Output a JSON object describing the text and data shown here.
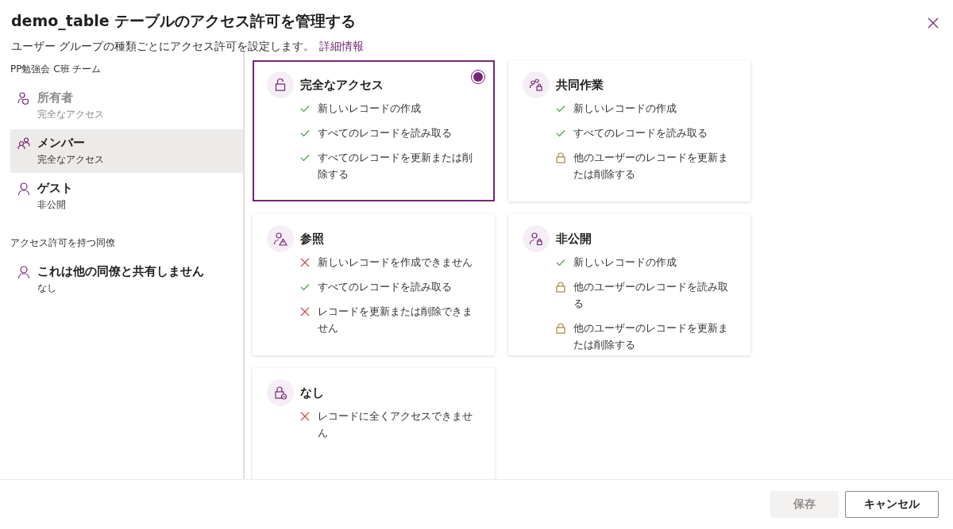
{
  "dialog": {
    "title_name": "demo_table",
    "title_rest": "テーブルのアクセス許可を管理する",
    "subtitle": "ユーザー グループの種類ごとにアクセス許可を設定します。",
    "link": "詳細情報"
  },
  "sidebar": {
    "sections": [
      {
        "heading": "PP勉強会 C班 チーム",
        "items": [
          {
            "name": "所有者",
            "access": "完全なアクセス",
            "selected": false,
            "disabled": true
          },
          {
            "name": "メンバー",
            "access": "完全なアクセス",
            "selected": true,
            "disabled": false
          },
          {
            "name": "ゲスト",
            "access": "非公開",
            "selected": false,
            "disabled": false
          }
        ]
      },
      {
        "heading": "アクセス許可を持つ同僚",
        "items": [
          {
            "name": "これは他の同僚と共有しません",
            "access": "なし",
            "selected": false,
            "disabled": false
          }
        ]
      }
    ]
  },
  "options": [
    {
      "title": "完全なアクセス",
      "selected": true,
      "features": [
        {
          "kind": "check",
          "text": "新しいレコードの作成"
        },
        {
          "kind": "check",
          "text": "すべてのレコードを読み取る"
        },
        {
          "kind": "check",
          "text": "すべてのレコードを更新または削除する"
        }
      ]
    },
    {
      "title": "共同作業",
      "selected": false,
      "features": [
        {
          "kind": "check",
          "text": "新しいレコードの作成"
        },
        {
          "kind": "check",
          "text": "すべてのレコードを読み取る"
        },
        {
          "kind": "lock",
          "text": "他のユーザーのレコードを更新または削除する"
        }
      ]
    },
    {
      "title": "参照",
      "selected": false,
      "features": [
        {
          "kind": "cross",
          "text": "新しいレコードを作成できません"
        },
        {
          "kind": "check",
          "text": "すべてのレコードを読み取る"
        },
        {
          "kind": "cross",
          "text": "レコードを更新または削除できません"
        }
      ]
    },
    {
      "title": "非公開",
      "selected": false,
      "features": [
        {
          "kind": "check",
          "text": "新しいレコードの作成"
        },
        {
          "kind": "lock",
          "text": "他のユーザーのレコードを読み取る"
        },
        {
          "kind": "lock",
          "text": "他のユーザーのレコードを更新または削除する"
        }
      ]
    },
    {
      "title": "なし",
      "selected": false,
      "features": [
        {
          "kind": "cross",
          "text": "レコードに全くアクセスできません"
        }
      ]
    }
  ],
  "footer": {
    "buttons": [
      {
        "label": "保存",
        "disabled": true
      },
      {
        "label": "キャンセル",
        "disabled": false
      }
    ]
  }
}
